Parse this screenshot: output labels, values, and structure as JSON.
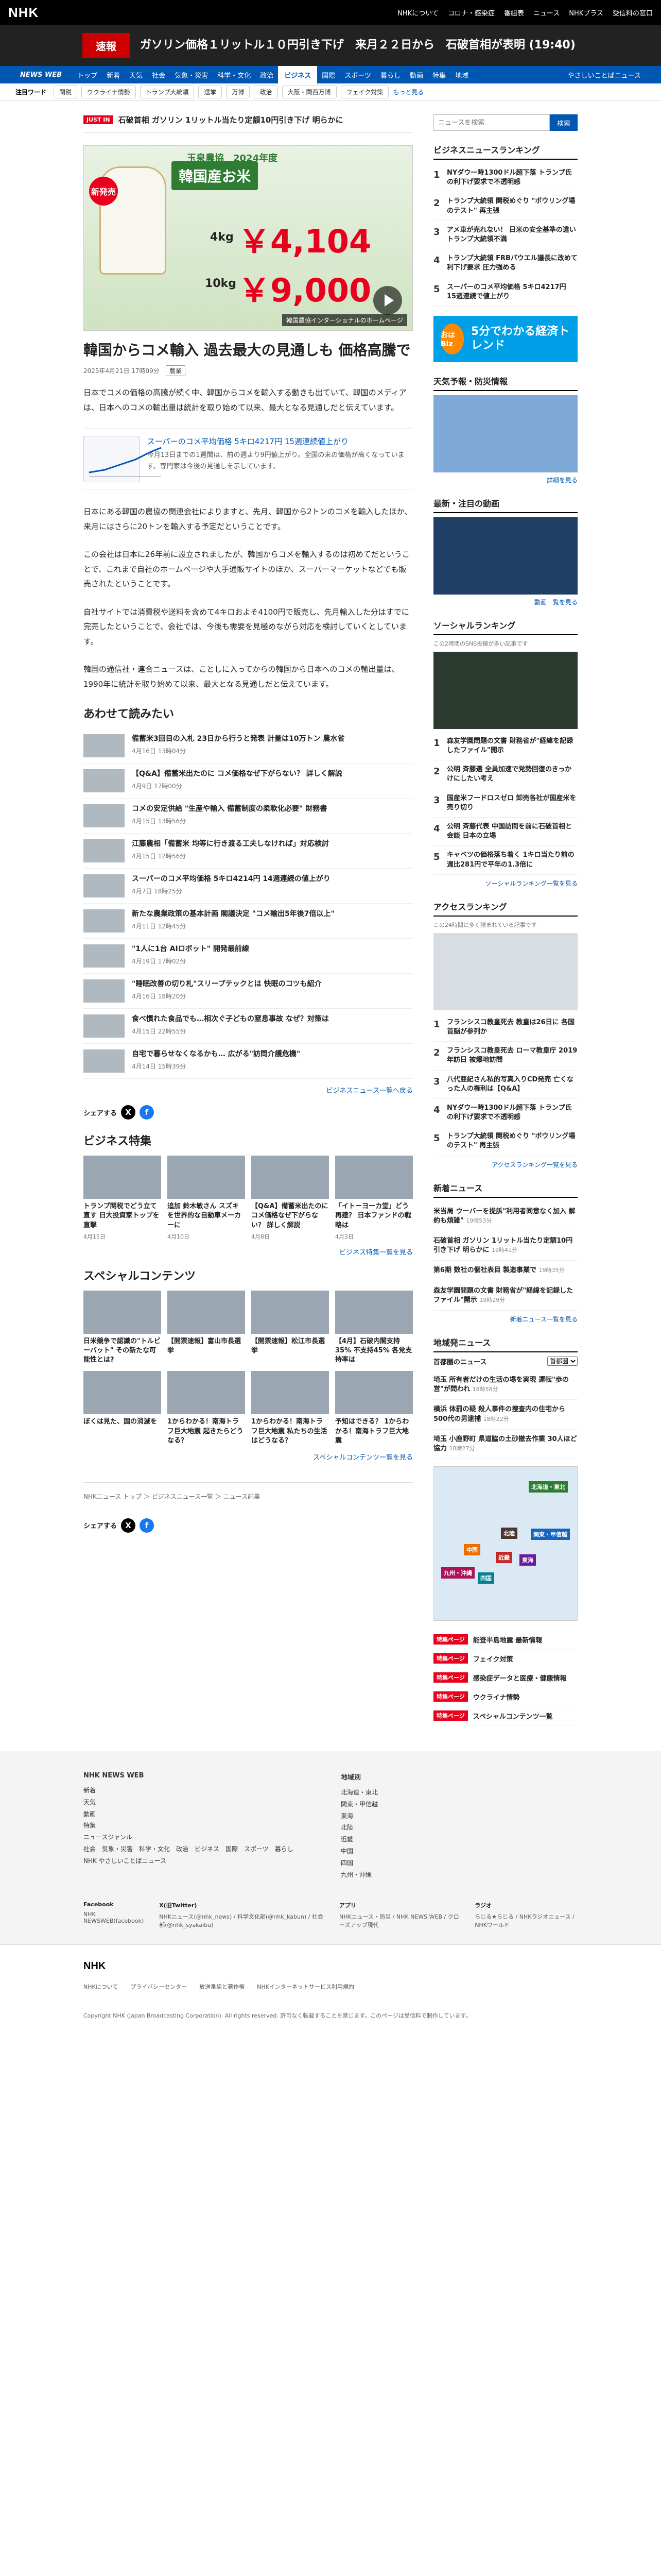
{
  "header": {
    "logo": "NHK",
    "nav": [
      "NHKについて",
      "コロナ・感染症",
      "番組表",
      "ニュース",
      "NHKプラス",
      "受信料の窓口"
    ]
  },
  "breaking": {
    "tag": "速報",
    "text": "ガソリン価格１リットル１０円引き下げ　来月２２日から　石破首相が表明 (19:40)"
  },
  "bluenav": {
    "brand": "NEWS WEB",
    "items": [
      "トップ",
      "新着",
      "天気",
      "社会",
      "気象・災害",
      "科学・文化",
      "政治",
      "ビジネス",
      "国際",
      "スポーツ",
      "暮らし",
      "動画",
      "特集",
      "地域"
    ],
    "active": "ビジネス",
    "right": "やさしいことばニュース"
  },
  "keywords": {
    "label": "注目ワード",
    "items": [
      "関税",
      "ウクライナ情勢",
      "トランプ大統領",
      "選挙",
      "万博",
      "政治",
      "大阪・関西万博",
      "フェイク対策"
    ],
    "more": "もっと見る"
  },
  "ticker": {
    "tag": "JUST IN",
    "text": "石破首相 ガソリン 1リットル当たり定額10円引き下げ 明らかに"
  },
  "hero": {
    "subtitle": "玉泉農協　2024年度",
    "title": "韓国産お米",
    "badge": "新発売",
    "weight1": "4kg",
    "price1": "￥4,104",
    "weight2": "10kg",
    "price2": "￥9,000",
    "caption": "韓国農協インターショナルのホームページ"
  },
  "article": {
    "title": "韓国からコメ輸入 過去最大の見通しも 価格高騰で",
    "date": "2025年4月21日 17時09分",
    "category": "農業",
    "p1": "日本でコメの価格の高騰が続く中、韓国からコメを輸入する動きも出ていて、韓国のメディアは、日本へのコメの輸出量は統計を取り始めて以来、最大となる見通しだと伝えています。",
    "related": {
      "title": "スーパーのコメ平均価格 5キロ4217円 15週連続値上がり",
      "desc": "今月13日までの1週間は、前の週より9円値上がり。全国の米の価格が高くなっています。専門家は今後の見通しを示しています。"
    },
    "p2": "日本にある韓国の農協の関連会社によりますと、先月、韓国から2トンのコメを輸入したほか、来月にはさらに20トンを輸入する予定だということです。",
    "p3": "この会社は日本に26年前に設立されましたが、韓国からコメを輸入するのは初めてだということで、これまで自社のホームページや大手通販サイトのほか、スーパーマーケットなどでも販売されたということです。",
    "p4": "自社サイトでは消費税や送料を含めて4キロおよそ4100円で販売し、先月輸入した分はすでに完売したということで、会社では、今後も需要を見極めながら対応を検討していくとしています。",
    "p5": "韓国の通信社・連合ニュースは、ことしに入ってからの韓国から日本へのコメの輸出量は、1990年に統計を取り始めて以来、最大となる見通しだと伝えています。"
  },
  "readtogether": {
    "heading": "あわせて読みたい",
    "items": [
      {
        "title": "備蓄米3回目の入札 23日から行うと発表 計量は10万トン 農水省",
        "date": "4月16日 13時04分"
      },
      {
        "title": "【Q&A】備蓄米出たのに コメ価格なぜ下がらない？ 詳しく解説",
        "date": "4月9日 17時00分"
      },
      {
        "title": "コメの安定供給 \"生産や輸入 備蓄制度の柔軟化必要\" 財務書",
        "date": "4月15日 13時56分"
      },
      {
        "title": "江藤農相「備蓄米 均等に行き渡る工夫しなければ」対応検討",
        "date": "4月15日 12時56分"
      },
      {
        "title": "スーパーのコメ平均価格 5キロ4214円 14週連続の値上がり",
        "date": "4月7日 18時25分"
      },
      {
        "title": "新たな農業政策の基本計画 閣議決定 \"コメ輸出5年後7倍以上\"",
        "date": "4月11日 12時45分"
      },
      {
        "title": "\"1人に1台 AIロボット\" 開発最前線",
        "date": "4月19日 17時02分"
      },
      {
        "title": "\"睡眠改善の切り札\"スリープテックとは 快眠のコツも紹介",
        "date": "4月16日 18時20分"
      },
      {
        "title": "食べ慣れた食品でも…相次ぐ子どもの窒息事故 なぜ？対策は",
        "date": "4月15日 22時55分"
      },
      {
        "title": "自宅で暮らせなくなるかも… 広がる\"訪問介護危機\"",
        "date": "4月14日 15時39分"
      }
    ],
    "more": "ビジネスニュース一覧へ戻る"
  },
  "share": {
    "label": "シェアする"
  },
  "bizfeature": {
    "heading": "ビジネス特集",
    "items": [
      {
        "title": "トランプ関税でどう立て直す 日大投資家トップを直撃",
        "date": "4月15日"
      },
      {
        "title": "追加 鈴木敏さん スズキを世界的な自動車メーカーに",
        "date": "4月10日"
      },
      {
        "title": "【Q&A】備蓄米出たのに コメ価格なぜ下がらない？ 詳しく解説",
        "date": "4月8日"
      },
      {
        "title": "「イトーヨーカ堂」どう再建？ 日本ファンドの戦略は",
        "date": "4月3日"
      }
    ],
    "more": "ビジネス特集一覧を見る"
  },
  "special": {
    "heading": "スペシャルコンテンツ",
    "items": [
      {
        "title": "日米競争で認識の\"トルビーバット\" その新たな可能性とは?"
      },
      {
        "title": "【開票速報】富山市長選挙"
      },
      {
        "title": "【開票速報】松江市長選挙"
      },
      {
        "title": "【4月】石破内閣支持35% 不支持45% 各党支持率は"
      },
      {
        "title": "ぼくは見た、国の消滅を"
      },
      {
        "title": "1からわかる！南海トラフ巨大地震 起きたらどうなる？"
      },
      {
        "title": "1からわかる！南海トラフ巨大地震 私たちの生活はどうなる？"
      },
      {
        "title": "予知はできる？ 1からわかる！南海トラフ巨大地震"
      }
    ],
    "more": "スペシャルコンテンツ一覧を見る"
  },
  "breadcrumb": [
    "NHKニュース トップ",
    "ビジネスニュース一覧",
    "ニュース記事"
  ],
  "sidebar": {
    "search_placeholder": "ニュースを検索",
    "search_button": "検索",
    "ranking": {
      "heading": "ビジネスニュースランキング",
      "items": [
        "NYダウ一時1300ドル超下落 トランプ氏の利下げ要求で不透明感",
        "トランプ大統領 関税めぐり \"ボウリング場のテスト\" 再主張",
        "アメ車が売れない！ 日米の安全基準の違い トランプ大統領不満",
        "トランプ大統領 FRBパウエル議長に改めて利下げ要求 圧力強める",
        "スーパーのコメ平均価格 5キロ4217円 15週連続で値上がり"
      ]
    },
    "banner": {
      "badge": "おはBiz",
      "text": "5分でわかる経済トレンド"
    },
    "weather": {
      "heading": "天気予報・防災情報",
      "link": "詳細を見る"
    },
    "latest": {
      "heading": "最新・注目の動画",
      "link": "動画一覧を見る"
    },
    "social": {
      "heading": "ソーシャルランキング",
      "sub": "この2時間のSNS投稿が多い記事です",
      "items": [
        "森友学園問題の文書 財務省が\"経緯を記録したファイル\"開示",
        "公明 斉藤選 全員加速で党勢回復のきっかけにしたい考え",
        "国産米フードロスゼロ 卸売各社が国産米を売り切り",
        "公明 斉藤代表 中国訪問を前に石破首相と会談 日本の立場",
        "キャベツの価格落ち着く 1キロ当たり前の週比281円で平年の1.3倍に"
      ],
      "more": "ソーシャルランキング一覧を見る"
    },
    "access": {
      "heading": "アクセスランキング",
      "sub": "この24時間に多く読まれている記事です",
      "items": [
        "フランシスコ教皇死去 教皇は26日に 各国首脳が参列か",
        "フランシスコ教皇死去 ローマ教皇庁 2019年訪日 被爆地訪問",
        "八代亜紀さん私的写真入りCD発売 亡くなった人の権利は【Q&A】",
        "NYダウ一時1300ドル超下落 トランプ氏の利下げ要求で不透明感",
        "トランプ大統領 関税めぐり \"ボウリング場のテスト\" 再主張"
      ],
      "more": "アクセスランキング一覧を見る"
    },
    "newest": {
      "heading": "新着ニュース",
      "items": [
        {
          "title": "米当局 ウーバーを提訴\"利用者同意なく加入 解約も煩雑\"",
          "date": "19時53分"
        },
        {
          "title": "石破首相 ガソリン 1リットル当たり定額10円引き下げ 明らかに",
          "date": "19時41分"
        },
        {
          "title": "第6期 数社の個社表目 製造事業で",
          "date": "19時35分"
        },
        {
          "title": "森友学園問題の文書 財務省が\"経緯を記録したファイル\"開示",
          "date": "19時29分"
        }
      ],
      "more": "新着ニュース一覧を見る"
    },
    "region": {
      "heading": "地域発ニュース",
      "area_label": "首都圏のニュース",
      "select": "首都圏",
      "items": [
        {
          "title": "埼玉 所有者だけの生活の場を実現 運転\"歩の営\"が問われ",
          "date": "18時58分"
        },
        {
          "title": "横浜 体罰の疑 殺人事件の捜査内の住宅から500代の男逮捕",
          "date": "18時22分"
        },
        {
          "title": "埼玉 小鹿野町 県道脇の土砂撤去作業 30人ほど協力",
          "date": "18時27分"
        }
      ],
      "map_regions": [
        "北海道・東北",
        "関東・甲信越",
        "東海",
        "近畿",
        "中国",
        "四国",
        "九州・沖縄",
        "北陸"
      ]
    },
    "specials": [
      {
        "badge": "特集ページ",
        "text": "能登半島地震 最新情報"
      },
      {
        "badge": "特集ページ",
        "text": "フェイク対策"
      },
      {
        "badge": "特集ページ",
        "text": "感染症データと医療・健康情報"
      },
      {
        "badge": "特集ページ",
        "text": "ウクライナ情勢"
      },
      {
        "badge": "特集ページ",
        "text": "スペシャルコンテンツ一覧"
      }
    ]
  },
  "footer": {
    "news_heading": "NHK NEWS WEB",
    "news_links": [
      "新着",
      "天気",
      "動画",
      "特集",
      "ニュースジャンル",
      "社会　気象・災害　科学・文化　政治　ビジネス　国際　スポーツ　暮らし",
      "NHK やさしいことばニュース"
    ],
    "region_heading": "地域別",
    "region_links": [
      "北海道・東北",
      "関東・甲信越",
      "東海",
      "北陸",
      "近畿",
      "中国",
      "四国",
      "九州・沖縄"
    ],
    "social": [
      {
        "h": "Facebook",
        "l": "NHK NEWSWEB(facebook)"
      },
      {
        "h": "X(旧Twitter)",
        "l": "NHKニュース(@nhk_news) / 科学文化部(@nhk_kabun) / 社会部(@nhk_syakaibu)"
      },
      {
        "h": "アプリ",
        "l": "NHKニュース・防災 / NHK NEWS WEB / クローズアップ現代"
      },
      {
        "h": "ラジオ",
        "l": "らじる★らじる / NHKラジオニュース / NHKワールド"
      }
    ],
    "bottom_logo": "NHK",
    "bottom_links": [
      "NHKについて",
      "プライバシーセンター",
      "放送番組と著作権",
      "NHKインターネットサービス利用規約"
    ],
    "copyright": "Copyright NHK (Japan Broadcasting Corporation). All rights reserved. 許可なく転載することを禁じます。このページは受信料で制作しています。"
  }
}
